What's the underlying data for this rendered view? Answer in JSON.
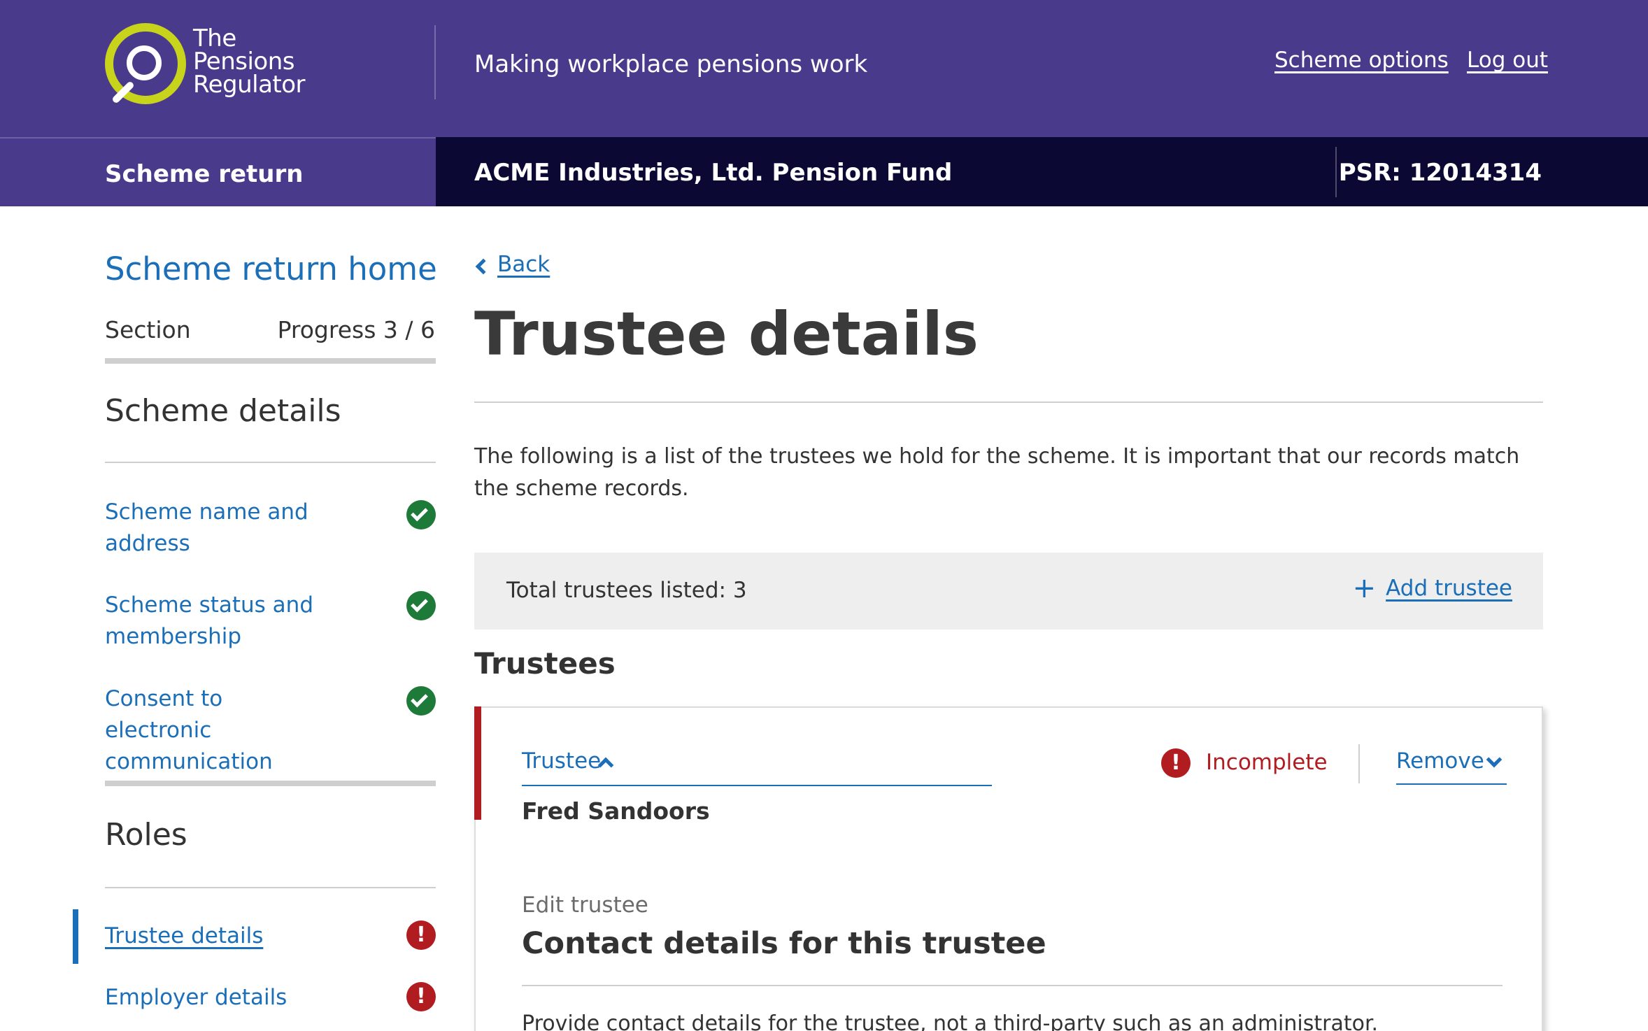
{
  "header": {
    "logo_text": "The\nPensions\nRegulator",
    "tagline": "Making workplace pensions work",
    "links": {
      "scheme_options": "Scheme options",
      "log_out": "Log out"
    },
    "subnav_title": "Scheme return",
    "scheme_name": "ACME Industries, Ltd. Pension Fund",
    "psr": "PSR: 12014314"
  },
  "sidebar": {
    "home_link": "Scheme return home",
    "section_label": "Section",
    "progress_label": "Progress 3 / 6",
    "groups": [
      {
        "heading": "Scheme details",
        "items": [
          {
            "label": "Scheme name and address",
            "status": "complete",
            "icon": "check-circle-icon"
          },
          {
            "label": "Scheme status and membership",
            "status": "complete",
            "icon": "check-circle-icon"
          },
          {
            "label": "Consent to electronic communication",
            "status": "complete",
            "icon": "check-circle-icon"
          }
        ]
      },
      {
        "heading": "Roles",
        "items": [
          {
            "label": "Trustee details",
            "status": "error",
            "icon": "error-icon",
            "current": true
          },
          {
            "label": "Employer details",
            "status": "error",
            "icon": "error-icon"
          }
        ]
      }
    ],
    "error_glyph": "!"
  },
  "main": {
    "back_link": "Back",
    "title": "Trustee details",
    "intro": "The following is a list of the trustees we hold for the scheme. It is important that our records match the scheme records.",
    "total_trustees": "Total trustees listed: 3",
    "add_trustee": "Add trustee",
    "add_icon": "+",
    "trustees_heading": "Trustees",
    "card": {
      "toggle_label": "Trustee",
      "status_label": "Incomplete",
      "remove_label": "Remove",
      "trustee_name": "Fred Sandoors",
      "edit_caption": "Edit trustee",
      "edit_title": "Contact details for this trustee",
      "description": "Provide contact details for the trustee, not a third-party such as an administrator."
    }
  },
  "colors": {
    "header_purple": "#4a3a8c",
    "header_dark": "#0b0833",
    "logo_accent": "#c8d41c",
    "link_blue": "#1b6eb8",
    "success_green": "#1e7a38",
    "error_red": "#b11c20"
  }
}
